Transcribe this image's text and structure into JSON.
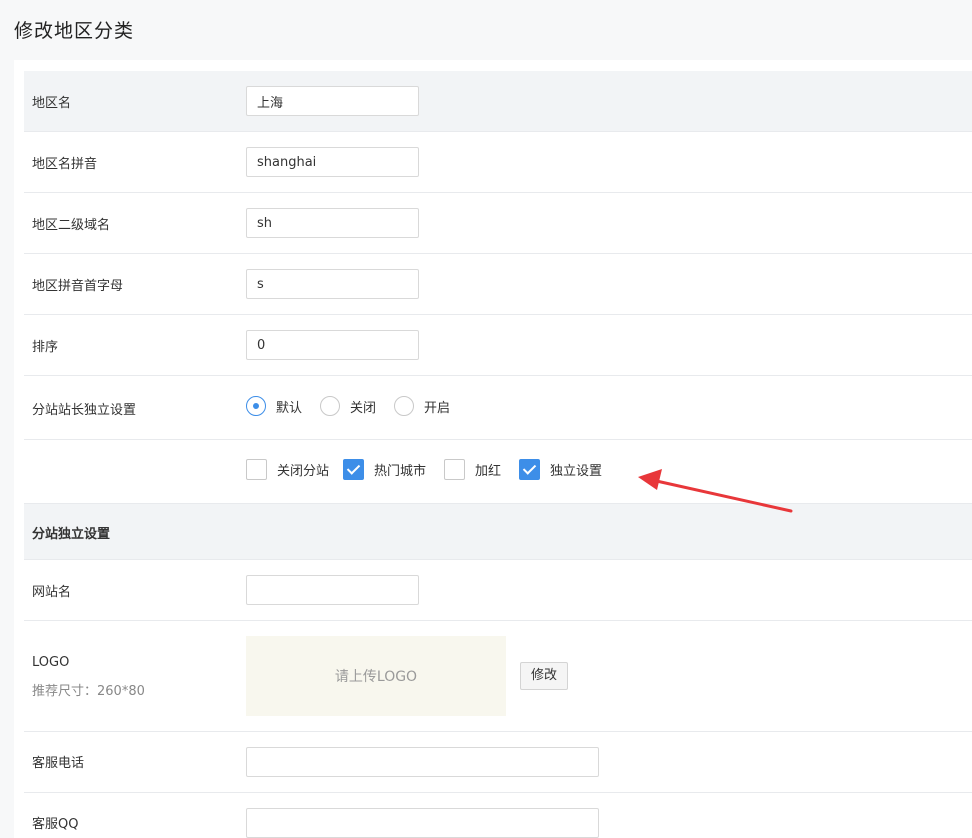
{
  "page": {
    "title": "修改地区分类"
  },
  "form": {
    "region_name": {
      "label": "地区名",
      "value": "上海"
    },
    "pinyin": {
      "label": "地区名拼音",
      "value": "shanghai"
    },
    "subdomain": {
      "label": "地区二级域名",
      "value": "sh"
    },
    "initial": {
      "label": "地区拼音首字母",
      "value": "s"
    },
    "sort": {
      "label": "排序",
      "value": "0"
    },
    "stationmaster": {
      "label": "分站站长独立设置",
      "options": [
        {
          "label": "默认",
          "checked": true
        },
        {
          "label": "关闭",
          "checked": false
        },
        {
          "label": "开启",
          "checked": false
        }
      ]
    },
    "flags": [
      {
        "label": "关闭分站",
        "checked": false
      },
      {
        "label": "热门城市",
        "checked": true
      },
      {
        "label": "加红",
        "checked": false
      },
      {
        "label": "独立设置",
        "checked": true
      }
    ]
  },
  "independent": {
    "section_title": "分站独立设置",
    "site_name": {
      "label": "网站名",
      "value": ""
    },
    "logo": {
      "label": "LOGO",
      "hint": "推荐尺寸：260*80",
      "placeholder": "请上传LOGO",
      "button": "修改"
    },
    "phone": {
      "label": "客服电话",
      "value": ""
    },
    "qq": {
      "label": "客服QQ",
      "value": ""
    }
  },
  "colors": {
    "accent": "#3d8ee8",
    "annotation": "#e8373a"
  }
}
